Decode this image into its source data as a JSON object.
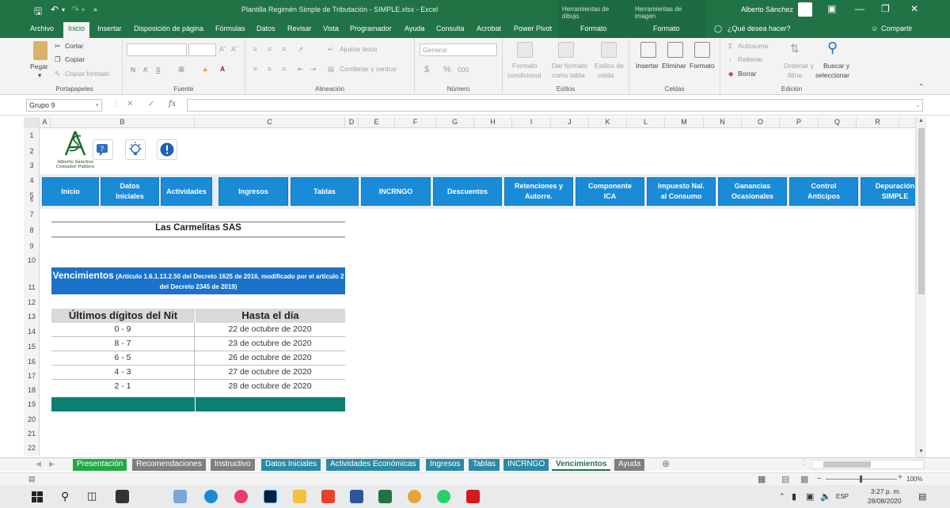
{
  "titlebar": {
    "title": "Plantilla Regimén Simple de Tributación - SIMPLE.xlsx  -  Excel",
    "tool1": "Herramientas de dibujo",
    "tool2": "Herramientas de imagen",
    "user": "Alberto Sánchez"
  },
  "tabs": {
    "archivo": "Archivo",
    "inicio": "Inicio",
    "insertar": "Insertar",
    "disposicion": "Disposición de página",
    "formulas": "Fórmulas",
    "datos": "Datos",
    "revisar": "Revisar",
    "vista": "Vista",
    "programador": "Programador",
    "ayuda": "Ayuda",
    "consulta": "Consulta",
    "acrobat": "Acrobat",
    "powerpivot": "Power Pivot",
    "formato1": "Formato",
    "formato2": "Formato",
    "tellme": "¿Qué desea hacer?",
    "compartir": "Compartir"
  },
  "ribbon": {
    "portapapeles": {
      "label": "Portapapeles",
      "pegar": "Pegar",
      "cortar": "Cortar",
      "copiar": "Copiar",
      "copiar_formato": "Copiar formato"
    },
    "fuente": {
      "label": "Fuente",
      "n": "N",
      "k": "K",
      "s": "S"
    },
    "alineacion": {
      "label": "Alineación",
      "ajustar": "Ajustar texto",
      "combinar": "Combinar y centrar"
    },
    "numero": {
      "label": "Número",
      "formato": "General",
      "moneda": "$",
      "porcentaje": "%",
      "miles": "000"
    },
    "estilos": {
      "label": "Estilos",
      "fc1": "Formato",
      "fc2": "condicional",
      "dt1": "Dar formato",
      "dt2": "como tabla",
      "ec1": "Estilos de",
      "ec2": "celda"
    },
    "celdas": {
      "label": "Celdas",
      "insertar": "Insertar",
      "eliminar": "Eliminar",
      "formato": "Formato"
    },
    "edicion": {
      "label": "Edición",
      "autosuma": "Autosuma",
      "rellenar": "Rellenar",
      "borrar": "Borrar",
      "of1": "Ordenar y",
      "of2": "filtrar",
      "bs1": "Buscar y",
      "bs2": "seleccionar"
    }
  },
  "formula_bar": {
    "name_box": "Grupo 9",
    "fx": "fx"
  },
  "columns": [
    "A",
    "B",
    "C",
    "D",
    "E",
    "F",
    "G",
    "H",
    "I",
    "J",
    "K",
    "L",
    "M",
    "N",
    "O",
    "P",
    "Q",
    "R"
  ],
  "rows": [
    "1",
    "2",
    "3",
    "4",
    "5",
    "6",
    "7",
    "8",
    "9",
    "10",
    "11",
    "12",
    "13",
    "14",
    "15",
    "16",
    "17",
    "18",
    "19",
    "20",
    "21",
    "22"
  ],
  "logo": {
    "line1": "Alberto Sánchez",
    "line2": "Contador Público"
  },
  "nav_buttons": [
    {
      "label": "Inicio"
    },
    {
      "label": "Datos\nIniciales"
    },
    {
      "label": "Actividades"
    },
    {
      "label": "Ingresos"
    },
    {
      "label": "Tablas"
    },
    {
      "label": "INCRNGO"
    },
    {
      "label": "Descuentos"
    },
    {
      "label": "Retenciones y\nAutorre."
    },
    {
      "label": "Componente\nICA"
    },
    {
      "label": "Impuesto Nal.\nal Consumo"
    },
    {
      "label": "Ganancias\nOcasionales"
    },
    {
      "label": "Control\nAnticipos"
    },
    {
      "label": "Depuración\nSIMPLE"
    }
  ],
  "company": "Las Carmelitas SAS",
  "vencimientos": {
    "title": "Vencimientos",
    "note": "(Artículo 1.6.1.13.2.50 del Decreto 1625 de 2016, modificado por el artículo 2 del Decreto 2345 de 2019)"
  },
  "table": {
    "headers": [
      "Últimos dígitos del Nit",
      "Hasta el día"
    ],
    "rows": [
      [
        "0 - 9",
        "22 de octubre de 2020"
      ],
      [
        "8 - 7",
        "23 de octubre de 2020"
      ],
      [
        "6 - 5",
        "26 de octubre de 2020"
      ],
      [
        "4 - 3",
        "27 de octubre de 2020"
      ],
      [
        "2 - 1",
        "28 de octubre de 2020"
      ]
    ]
  },
  "sheet_tabs": [
    {
      "label": "Presentación",
      "color": "#21a846"
    },
    {
      "label": "Recomendaciones",
      "color": "#7f7f7f"
    },
    {
      "label": "Instructivo",
      "color": "#7f7f7f"
    },
    {
      "label": "Datos Iniciales",
      "color": "#2a8aa6"
    },
    {
      "label": "Actividades Económicas",
      "color": "#2a8aa6"
    },
    {
      "label": "Ingresos",
      "color": "#2a8aa6"
    },
    {
      "label": "Tablas",
      "color": "#2a8aa6"
    },
    {
      "label": "INCRNGO",
      "color": "#2a8aa6"
    },
    {
      "label": "Vencimientos",
      "color": "#ffffff",
      "active": true
    },
    {
      "label": "Ayuda",
      "color": "#7f7f7f"
    }
  ],
  "status": {
    "zoom": "100%"
  },
  "taskbar": {
    "time": "3:27 p. m.",
    "date": "28/08/2020",
    "lang": "ESP"
  },
  "colors": {
    "excel_green": "#217346",
    "nav_blue": "#1a8bd6",
    "venc_blue": "#1a73c9",
    "teal": "#0d8072"
  }
}
